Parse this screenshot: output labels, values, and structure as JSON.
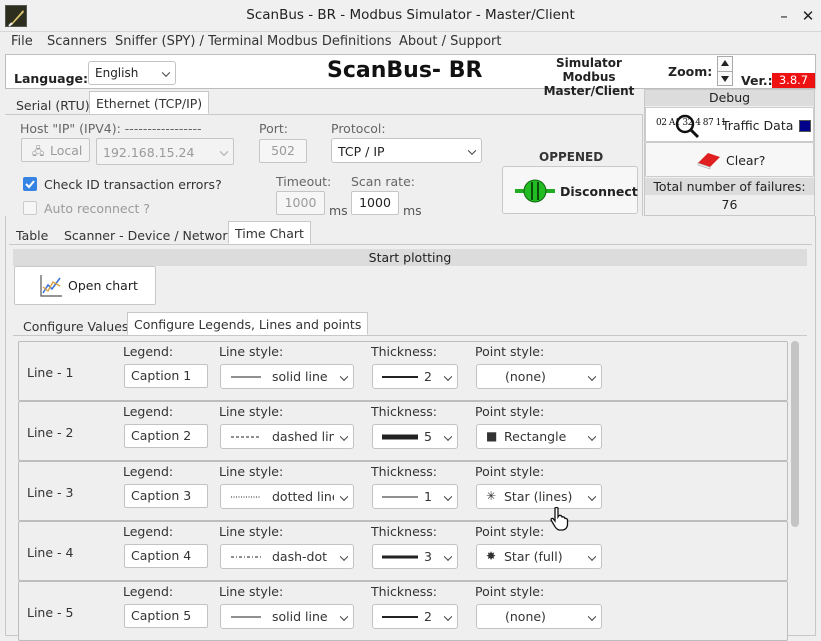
{
  "window": {
    "title": "ScanBus - BR - Modbus Simulator - Master/Client",
    "min": "–",
    "close": "✕",
    "max": "⧉"
  },
  "menu": [
    "File",
    "Scanners",
    "Sniffer (SPY) / Terminal",
    "Modbus Definitions",
    "About / Support"
  ],
  "header": {
    "language_label": "Language:",
    "language_value": "English",
    "app_name": "ScanBus- BR",
    "subtitle_line1": "Simulator Modbus",
    "subtitle_line2": "Master/Client",
    "zoom_label": "Zoom:",
    "ver_label": "Ver.:",
    "ver_value": "3.8.7",
    "ver_color": "#ee1111"
  },
  "conn_tabs": [
    "Serial (RTU)",
    "Ethernet (TCP/IP)"
  ],
  "conn": {
    "host_label": "Host \"IP\" (IPV4): -----------------",
    "local_label": "Local",
    "ip_value": "192.168.15.24",
    "port_label": "Port:",
    "port_value": "502",
    "protocol_label": "Protocol:",
    "protocol_value": "TCP / IP",
    "check_id_label": "Check ID transaction errors?",
    "check_id_checked": true,
    "auto_reconnect_label": "Auto reconnect ?",
    "timeout_label": "Timeout:",
    "timeout_value": "1000",
    "timeout_unit": "ms",
    "scan_label": "Scan rate:",
    "scan_value": "1000",
    "scan_unit": "ms",
    "status": "OPPENED",
    "disconnect_label": "Disconnect"
  },
  "debug": {
    "title": "Debug",
    "traffic_label": "Traffic Data",
    "traffic_icon_text": "02 A1 32 4 87 11",
    "clear_label": "Clear?",
    "failures_label": "Total number of failures:",
    "failures_value": "76"
  },
  "main_tabs": [
    "Table",
    "Scanner - Device / Network",
    "Time Chart"
  ],
  "chart": {
    "start_label": "Start plotting",
    "open_chart_label": "Open chart"
  },
  "sub_tabs": [
    "Configure Values",
    "Configure Legends, Lines and points"
  ],
  "col_labels": {
    "legend": "Legend:",
    "line_style": "Line style:",
    "thickness": "Thickness:",
    "point_style": "Point style:"
  },
  "lines": [
    {
      "name": "Line - 1",
      "caption": "Caption 1",
      "style": "solid line",
      "thickness": "2",
      "point": "(none)",
      "point_icon": ""
    },
    {
      "name": "Line - 2",
      "caption": "Caption 2",
      "style": "dashed line",
      "thickness": "5",
      "point": "Rectangle",
      "point_icon": "■"
    },
    {
      "name": "Line - 3",
      "caption": "Caption 3",
      "style": "dotted line",
      "thickness": "1",
      "point": "Star (lines)",
      "point_icon": "✳"
    },
    {
      "name": "Line - 4",
      "caption": "Caption 4",
      "style": "dash-dot",
      "thickness": "3",
      "point": "Star (full)",
      "point_icon": "✸"
    },
    {
      "name": "Line - 5",
      "caption": "Caption 5",
      "style": "solid line",
      "thickness": "2",
      "point": "(none)",
      "point_icon": ""
    }
  ]
}
